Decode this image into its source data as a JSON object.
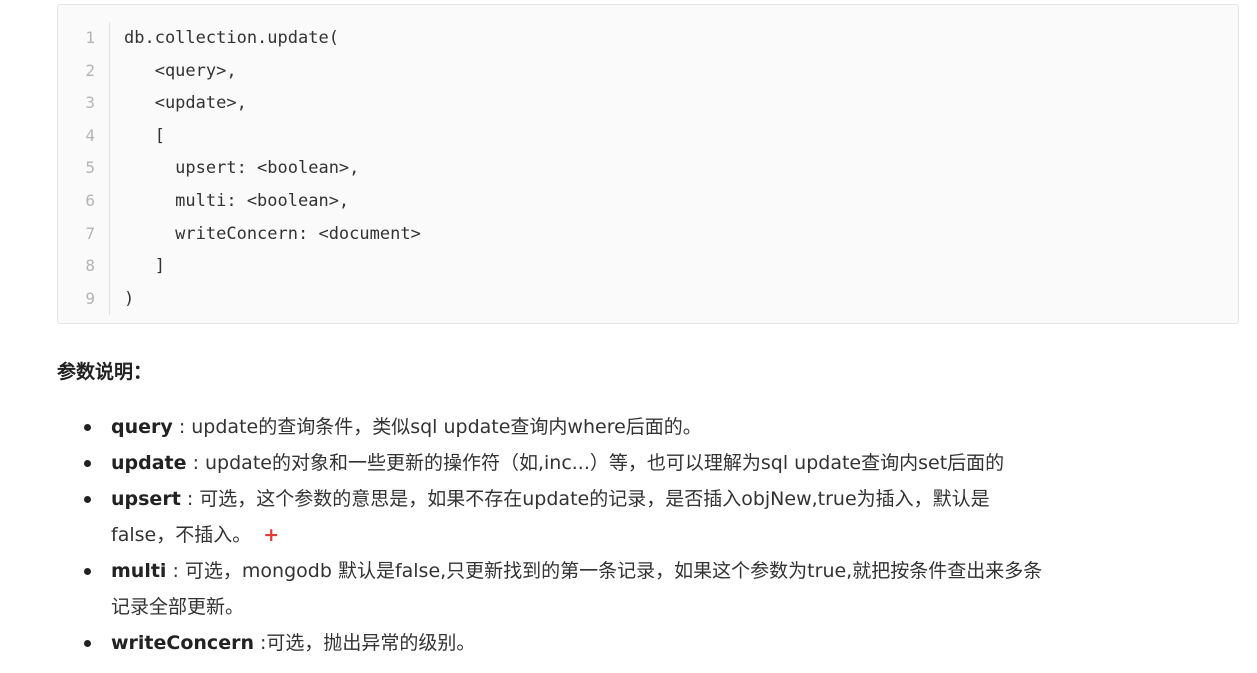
{
  "code": {
    "line_numbers": [
      "1",
      "2",
      "3",
      "4",
      "5",
      "6",
      "7",
      "8",
      "9"
    ],
    "lines": [
      "db.collection.update(",
      "   <query>,",
      "   <update>,",
      "   [",
      "     upsert: <boolean>,",
      "     multi: <boolean>,",
      "     writeConcern: <document>",
      "   ]",
      ")"
    ]
  },
  "params": {
    "heading": "参数说明：",
    "items": [
      {
        "name": "query",
        "desc": " : update的查询条件，类似sql update查询内where后面的。",
        "desc_cont": ""
      },
      {
        "name": "update",
        "desc": " : update的对象和一些更新的操作符（如,inc...）等，也可以理解为sql update查询内set后面的",
        "desc_cont": ""
      },
      {
        "name": "upsert",
        "desc": " : 可选，这个参数的意思是，如果不存在update的记录，是否插入objNew,true为插入，默认是",
        "desc_cont": "false，不插入。",
        "plus": "+"
      },
      {
        "name": "multi",
        "desc": " : 可选，mongodb 默认是false,只更新找到的第一条记录，如果这个参数为true,就把按条件查出来多条",
        "desc_cont": "记录全部更新。"
      },
      {
        "name": "writeConcern",
        "desc": " :可选，抛出异常的级别。",
        "desc_cont": ""
      }
    ]
  }
}
